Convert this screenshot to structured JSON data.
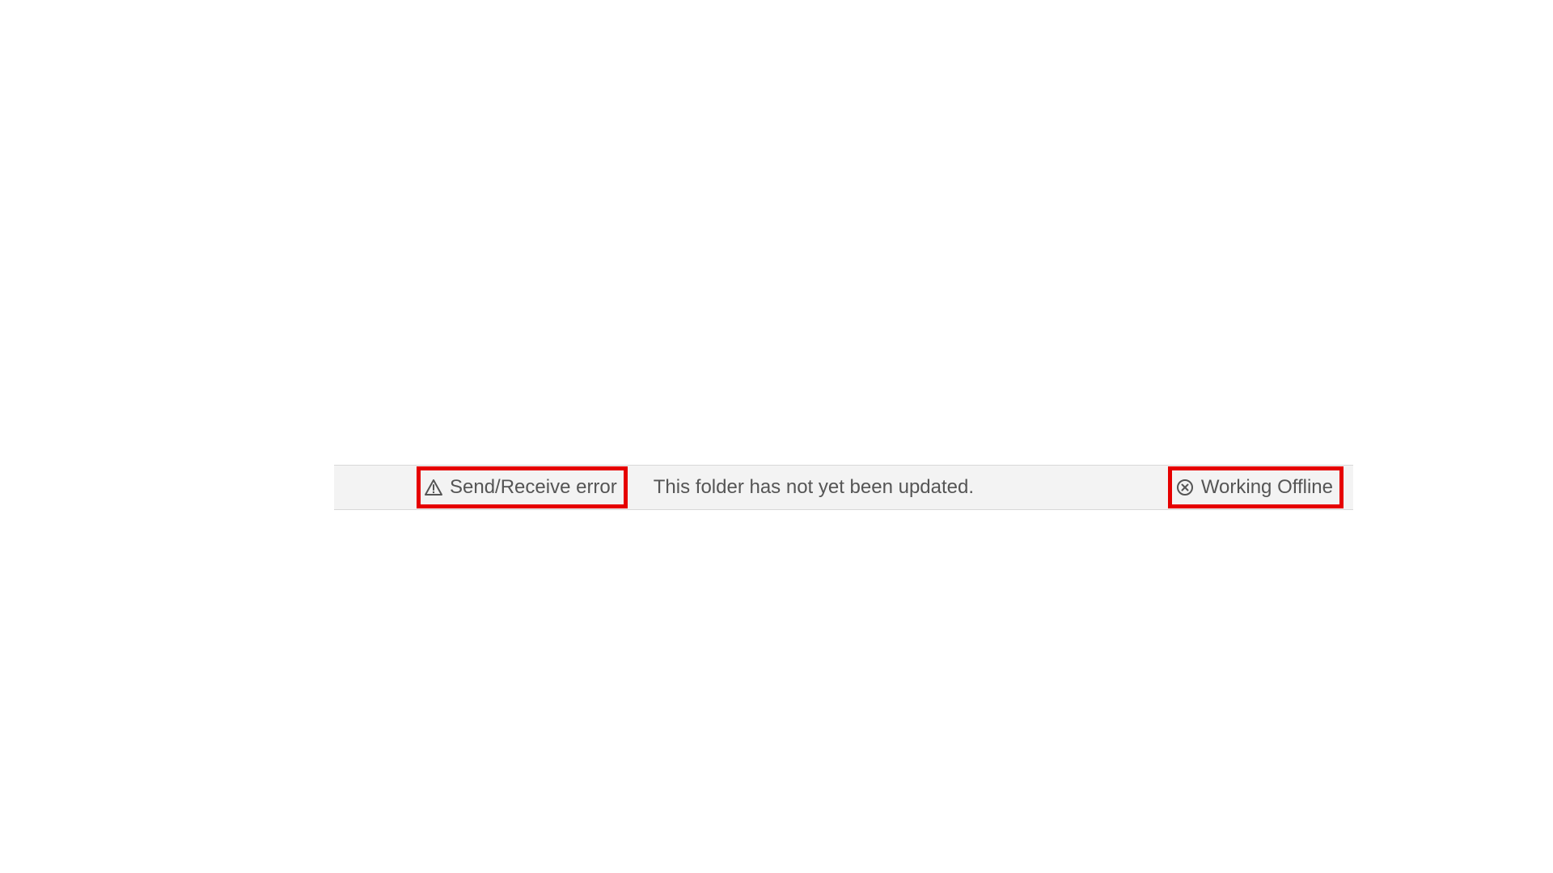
{
  "status_bar": {
    "send_receive_error_label": "Send/Receive error",
    "folder_status_label": "This folder has not yet been updated.",
    "working_offline_label": "Working Offline"
  },
  "icons": {
    "warning": "warning-triangle-icon",
    "offline": "error-circle-x-icon"
  },
  "colors": {
    "highlight": "#e60000",
    "bar_bg": "#f3f3f3",
    "text": "#555555"
  }
}
